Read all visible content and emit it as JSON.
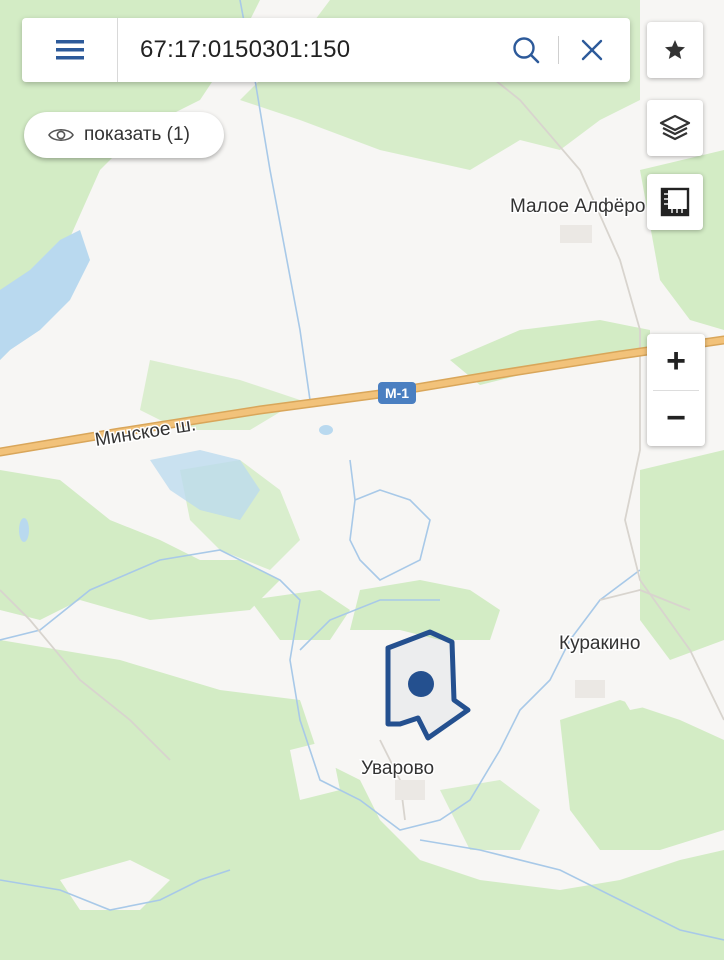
{
  "search": {
    "query": "67:17:0150301:150"
  },
  "show_button": {
    "label": "показать (1)"
  },
  "zoom": {
    "in_label": "+",
    "out_label": "−"
  },
  "map": {
    "labels": {
      "maloe_alfyorovo": "Малое Алфёро",
      "minskoe": "Минское ш.",
      "m1": "М-1",
      "kurakino": "Куракино",
      "uvarovo": "Уварово"
    },
    "colors": {
      "forest": "#d3ecc5",
      "land": "#f7f6f4",
      "highway": "#f2c27a",
      "water": "#b9d9ef",
      "parcel_outline": "#24508f",
      "ui_accent": "#2d5a9a"
    }
  }
}
